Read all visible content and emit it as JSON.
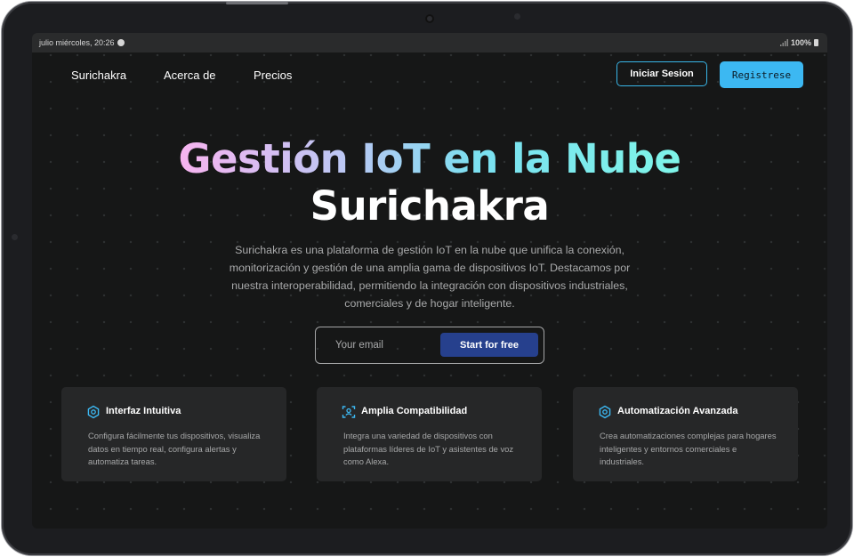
{
  "statusbar": {
    "time": "julio miércoles, 20:26",
    "battery": "100%"
  },
  "nav": {
    "brand": "Surichakra",
    "about": "Acerca de",
    "pricing": "Precios",
    "login": "Iniciar Sesion",
    "register": "Registrese"
  },
  "hero": {
    "title_gradient": "Gestión IoT en la Nube",
    "title_brand": "Surichakra",
    "description": "Surichakra es una plataforma de gestión IoT en la nube que unifica la conexión, monitorización y gestión de una amplia gama de dispositivos IoT. Destacamos por nuestra interoperabilidad, permitiendo la integración con dispositivos industriales, comerciales y de hogar inteligente."
  },
  "signup": {
    "email_placeholder": "Your email",
    "email_value": "",
    "button": "Start for free"
  },
  "features": [
    {
      "icon": "hexagon-icon",
      "title": "Interfaz Intuitiva",
      "text": "Configura fácilmente tus dispositivos, visualiza datos en tiempo real, configura alertas y automatiza tareas."
    },
    {
      "icon": "scan-icon",
      "title": "Amplia Compatibilidad",
      "text": "Integra una variedad de dispositivos con plataformas líderes de IoT y asistentes de voz como Alexa."
    },
    {
      "icon": "hexagon-icon",
      "title": "Automatización Avanzada",
      "text": "Crea automatizaciones complejas para hogares inteligentes y entornos comerciales e industriales."
    }
  ],
  "colors": {
    "accent": "#3cb8f2",
    "cta": "#26408d",
    "background": "#161717",
    "card": "#262728"
  }
}
